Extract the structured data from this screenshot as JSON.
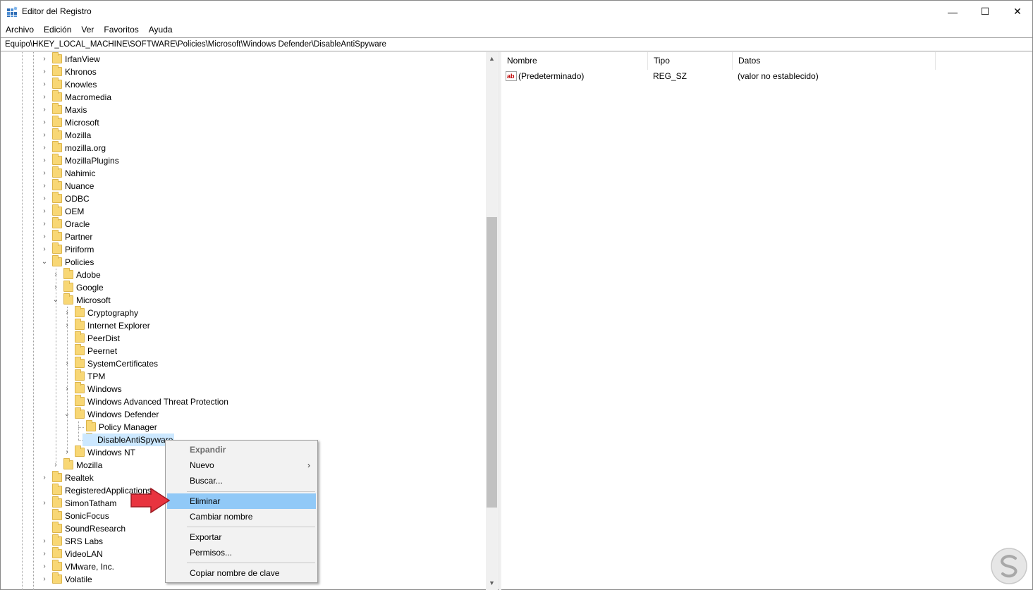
{
  "window": {
    "title": "Editor del Registro",
    "minimize": "—",
    "maximize": "☐",
    "close": "✕"
  },
  "menu": [
    "Archivo",
    "Edición",
    "Ver",
    "Favoritos",
    "Ayuda"
  ],
  "address": "Equipo\\HKEY_LOCAL_MACHINE\\SOFTWARE\\Policies\\Microsoft\\Windows Defender\\DisableAntiSpyware",
  "tree": {
    "level1": [
      "IrfanView",
      "Khronos",
      "Knowles",
      "Macromedia",
      "Maxis",
      "Microsoft",
      "Mozilla",
      "mozilla.org",
      "MozillaPlugins",
      "Nahimic",
      "Nuance",
      "ODBC",
      "OEM",
      "Oracle",
      "Partner",
      "Piriform",
      "Policies"
    ],
    "policies_children": [
      "Adobe",
      "Google",
      "Microsoft"
    ],
    "microsoft_children": [
      "Cryptography",
      "Internet Explorer",
      "PeerDist",
      "Peernet",
      "SystemCertificates",
      "TPM",
      "Windows",
      "Windows Advanced Threat Protection",
      "Windows Defender"
    ],
    "defender_children": [
      "Policy Manager",
      "DisableAntiSpyware"
    ],
    "after_defender": "Windows NT",
    "after_microsoft": "Mozilla",
    "level1_after": [
      "Realtek",
      "RegisteredApplications",
      "SimonTatham",
      "SonicFocus",
      "SoundResearch",
      "SRS Labs",
      "VideoLAN",
      "VMware, Inc.",
      "Volatile"
    ]
  },
  "columns": {
    "name": "Nombre",
    "type": "Tipo",
    "data": "Datos"
  },
  "values": [
    {
      "icon": "string-value-icon",
      "icon_text": "ab",
      "name": "(Predeterminado)",
      "type": "REG_SZ",
      "data": "(valor no establecido)"
    }
  ],
  "context_menu": {
    "expand": "Expandir",
    "new": "Nuevo",
    "new_arrow": "›",
    "find": "Buscar...",
    "delete": "Eliminar",
    "rename": "Cambiar nombre",
    "export": "Exportar",
    "permissions": "Permisos...",
    "copy_key": "Copiar nombre de clave"
  },
  "scroll": {
    "up": "▲",
    "down": "▼"
  },
  "colors": {
    "selected_bg": "#cce8ff",
    "menu_highlight": "#91c9f7",
    "folder": "#f8d775",
    "arrow": "#e8343f"
  }
}
